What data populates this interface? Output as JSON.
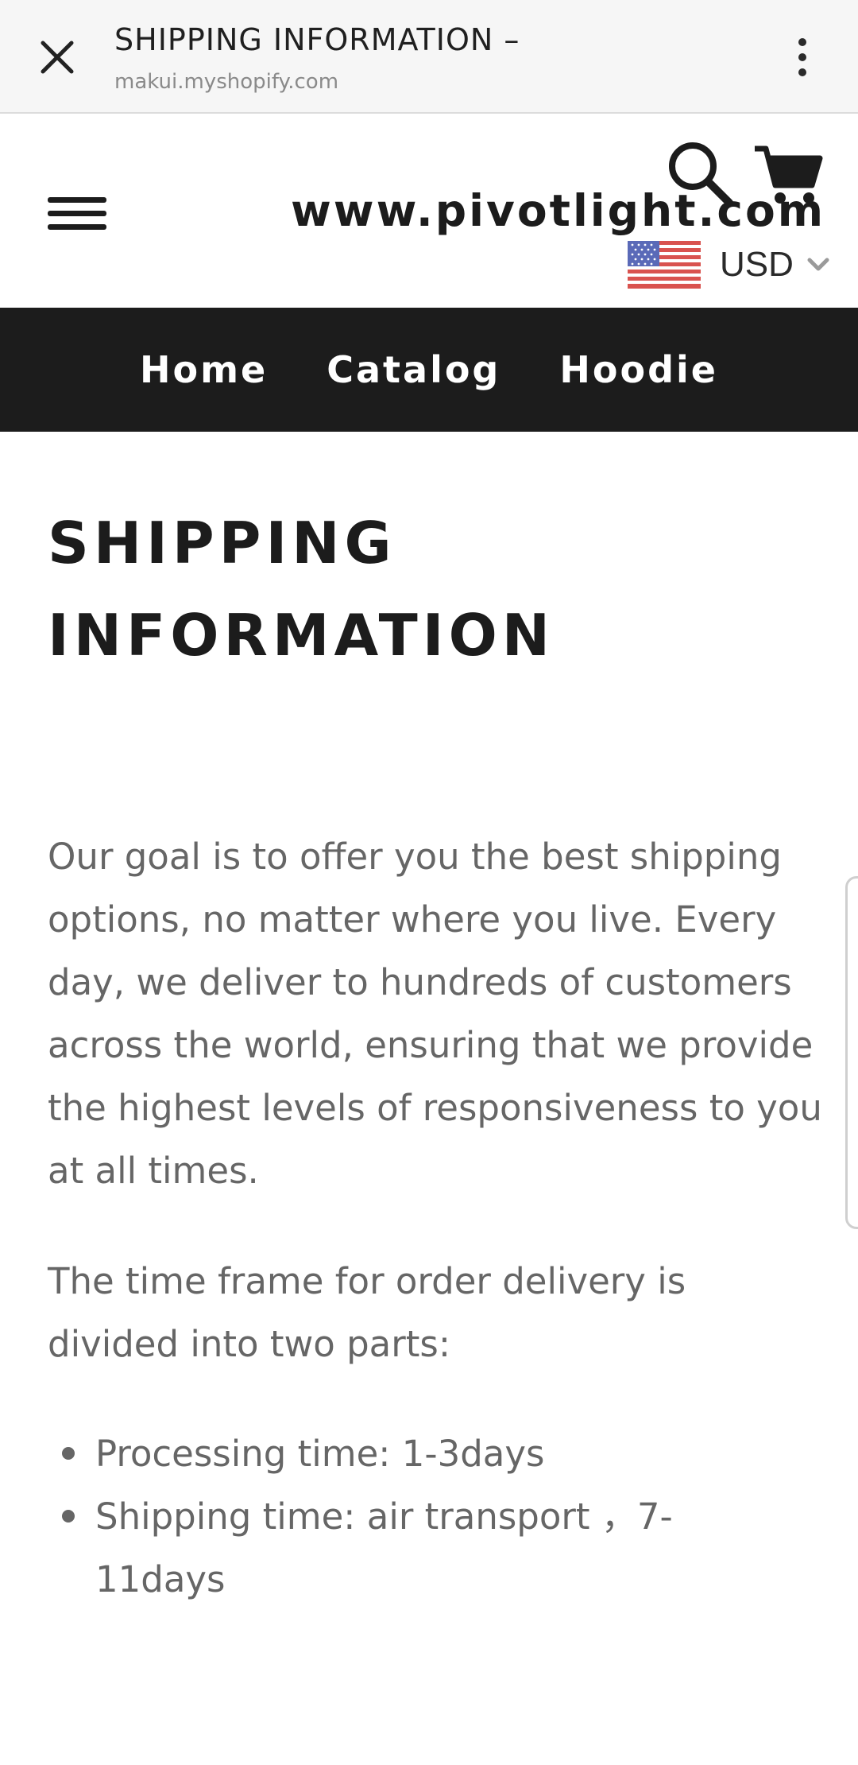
{
  "browser_bar": {
    "title": "SHIPPING INFORMATION –",
    "url": "makui.myshopify.com",
    "close_icon": "close-icon",
    "more_icon": "more-vert-icon"
  },
  "header": {
    "logo_text": "www.pivotlight.com",
    "menu_icon": "hamburger-menu-icon",
    "search_icon": "search-icon",
    "cart_icon": "cart-icon",
    "currency": {
      "selected": "USD",
      "flag_icon": "us-flag-icon",
      "dropdown_icon": "chevron-down-icon"
    }
  },
  "nav": {
    "items": [
      "Home",
      "Catalog",
      "Hoodie"
    ]
  },
  "content": {
    "title_line1": "SHIPPING",
    "title_line2": "INFORMATION",
    "paragraph1": "Our goal is to offer you the best shipping options, no matter where you live. Every day, we deliver to hundreds of customers across the world, ensuring that we provide the highest levels of responsiveness to you at all times.",
    "paragraph2": "The time frame for order delivery is divided into two parts:",
    "bullets": [
      "Processing time: 1-3days",
      "Shipping time: air transport ，7-11days"
    ]
  },
  "colors": {
    "nav_background": "#1c1c1c",
    "nav_text": "#ffffff",
    "body_text": "#666666",
    "heading_text": "#1c1c1c",
    "topbar_background": "#f6f6f6"
  }
}
